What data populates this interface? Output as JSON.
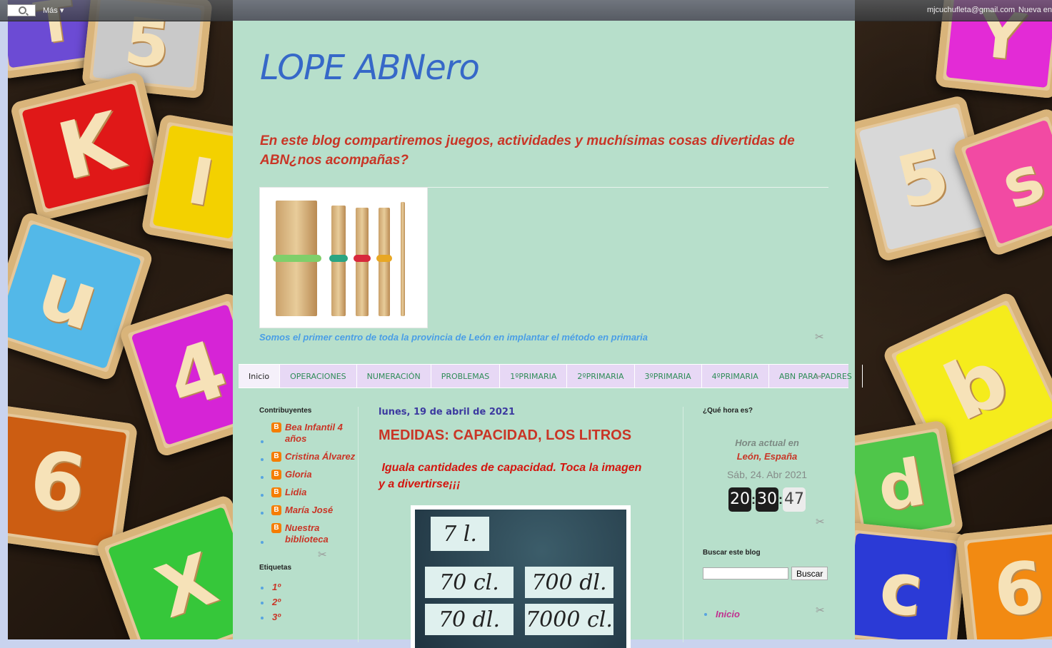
{
  "navbar": {
    "more_label": "Más ▾",
    "email": "mjcuchufleta@gmail.com",
    "new_label": "Nueva en"
  },
  "blog": {
    "title": "LOPE ABNero",
    "description": "En este blog compartiremos juegos, actividades y muchísimas cosas divertidas de ABN¿nos acompañas?",
    "image_caption": "Somos el primer centro de toda la provincia de León en implantar el método en primaria"
  },
  "tabs": [
    {
      "label": "Inicio",
      "active": true
    },
    {
      "label": "OPERACIONES"
    },
    {
      "label": "NUMERACIÓN"
    },
    {
      "label": "PROBLEMAS"
    },
    {
      "label": "1ºPRIMARIA"
    },
    {
      "label": "2ºPRIMARIA"
    },
    {
      "label": "3ºPRIMARIA"
    },
    {
      "label": "4ºPRIMARIA"
    },
    {
      "label": "ABN PARA PADRES"
    }
  ],
  "left_sidebar": {
    "contributors_title": "Contribuyentes",
    "contributors": [
      "Bea Infantil 4 años",
      "Cristina Álvarez",
      "Gloria",
      "Lidia",
      "María José",
      "Nuestra biblioteca"
    ],
    "labels_title": "Etiquetas",
    "labels": [
      "1º",
      "2º",
      "3º"
    ]
  },
  "post": {
    "date": "lunes, 19 de abril de 2021",
    "title": "MEDIDAS: CAPACIDAD, LOS LITROS",
    "body_line1": "Iguala cantidades de capacidad. Toca la imagen",
    "body_line2": "y a divertirse¡¡¡",
    "image_cards": [
      "7 l.",
      "70 cl.",
      "700 dl.",
      "70 dl.",
      "7000 cl."
    ]
  },
  "right_sidebar": {
    "clock_title": "¿Qué hora es?",
    "clock_city_line1": "Hora actual en",
    "clock_city_line2": "León, España",
    "clock_date": "Sáb, 24. Abr 2021",
    "hours": "20",
    "minutes": "30",
    "seconds": "47",
    "search_title": "Buscar este blog",
    "search_button": "Buscar",
    "pages": [
      "Inicio"
    ]
  },
  "colors": {
    "page_bg": "#b7dfcb",
    "title": "#3668c8",
    "accent_red": "#c93526",
    "tab_bg": "#e7d8f5",
    "tab_text": "#2e8c57",
    "link_pink": "#c12f8f"
  }
}
